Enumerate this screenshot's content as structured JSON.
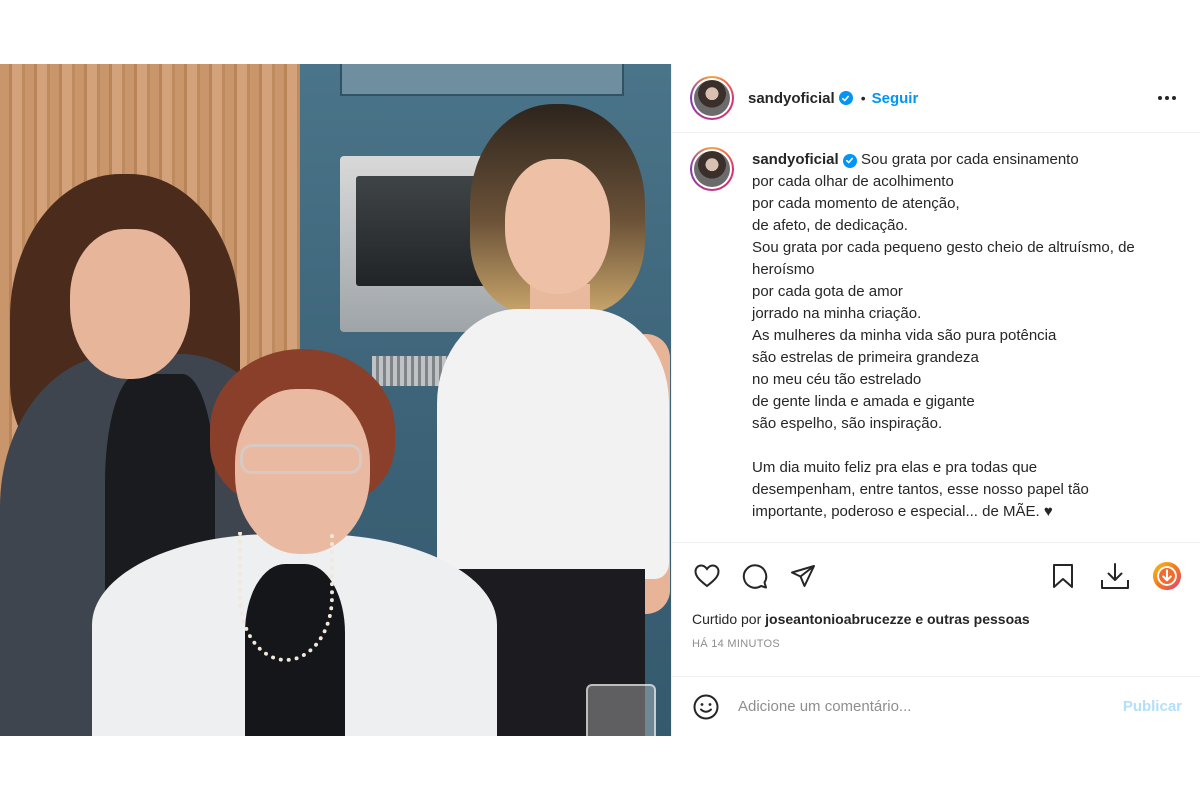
{
  "post": {
    "username": "sandyoficial",
    "follow_label": "Seguir",
    "separator": "•",
    "caption_lines": [
      "Sou grata por cada ensinamento",
      "por cada olhar de acolhimento",
      "por cada momento de atenção,",
      "de afeto, de dedicação.",
      "Sou grata por cada pequeno gesto cheio de altruísmo, de",
      "heroísmo",
      "por cada gota de amor",
      "jorrado na minha criação.",
      "As mulheres da minha vida são pura potência",
      "são estrelas de primeira grandeza",
      "no meu céu tão estrelado",
      "de gente linda e amada e gigante",
      "são espelho, são inspiração."
    ],
    "caption_lines_2": [
      "Um dia muito feliz pra elas e pra todas que",
      "desempenham, entre tantos, esse nosso papel tão",
      "importante, poderoso e especial... de MÃE. ♥"
    ],
    "likes_prefix": "Curtido por",
    "likes_user": "joseantonioabrucezze",
    "likes_suffix": "e outras pessoas",
    "timestamp": "HÁ 14 MINUTOS",
    "comment_placeholder": "Adicione um comentário...",
    "publish_label": "Publicar"
  },
  "icons": {
    "more": "more-options-icon",
    "verified": "verified-badge-icon",
    "like": "heart-icon",
    "comment": "comment-icon",
    "share": "share-icon",
    "save": "bookmark-icon",
    "download": "download-icon",
    "extension": "extension-icon",
    "emoji": "emoji-icon"
  },
  "colors": {
    "accent": "#0095f6",
    "publish_disabled": "#b2dffc",
    "muted": "#8e8e8e",
    "text": "#262626"
  }
}
